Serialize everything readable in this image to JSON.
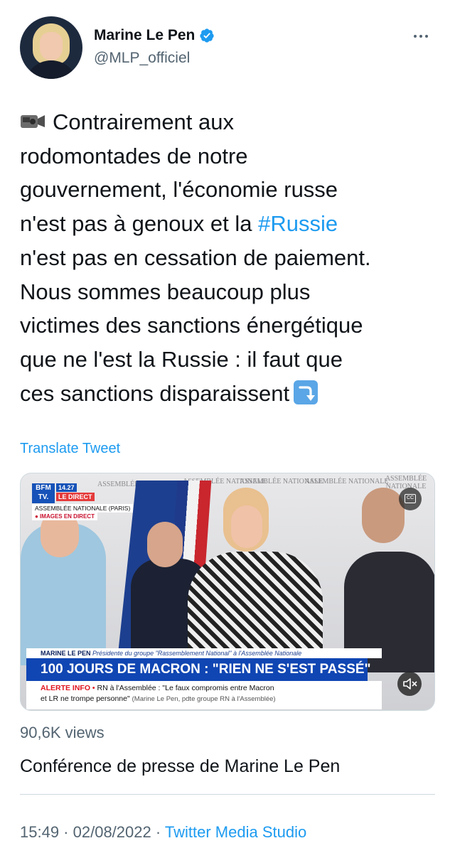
{
  "author": {
    "name": "Marine Le Pen",
    "handle": "@MLP_officiel",
    "verified": true
  },
  "tweet": {
    "lines": [
      "Contrairement aux",
      "rodomontades de notre",
      "gouvernement, l'économie russe",
      "n'est pas à genoux et la ",
      "n'est pas en cessation de paiement.",
      "Nous sommes beaucoup plus",
      "victimes des sanctions énergétique",
      "que ne l'est la Russie : il faut que",
      "ces sanctions disparaissent"
    ],
    "hashtag": "#Russie",
    "leading_emoji": "video-camera-icon",
    "trailing_emoji": "arrow-down-icon"
  },
  "translate_label": "Translate Tweet",
  "video": {
    "channel_logo": "BFM TV.",
    "time": "14.27",
    "live_label": "LE DIRECT",
    "location": "ASSEMBLÉE NATIONALE (PARIS)",
    "images_label": "● IMAGES EN DIRECT",
    "cc_label": "CC",
    "wall_signs": [
      "ASSEMBLÉE NATIONALE",
      "ASSEMBLÉE NATIONALE",
      "ASSEMBLÉE NATIONALE",
      "ASSEMBLÉE NATIONALE",
      "ASSEMBLÉE NATIONALE"
    ],
    "name_strip_name": "MARINE LE PEN",
    "name_strip_role": "Présidente du groupe \"Rassemblement National\" à l'Assemblée Nationale",
    "headline": "100 JOURS DE MACRON : \"RIEN NE S'EST PASSÉ\"",
    "alert_label": "ALERTE INFO •",
    "alert_text_1": "RN à l'Assemblée : \"Le faux compromis entre Macron",
    "alert_text_2": "et LR ne trompe personne\"",
    "alert_credit": "(Marine Le Pen, pdte groupe RN à l'Assemblée)"
  },
  "stats": {
    "views": "90,6K views"
  },
  "media_title": "Conférence de presse de Marine Le Pen",
  "meta": {
    "time": "15:49",
    "separator": " · ",
    "date": "02/08/2022",
    "source": "Twitter Media Studio"
  },
  "colors": {
    "accent": "#1d9bf0",
    "text": "#0f1419",
    "secondary": "#536471"
  }
}
